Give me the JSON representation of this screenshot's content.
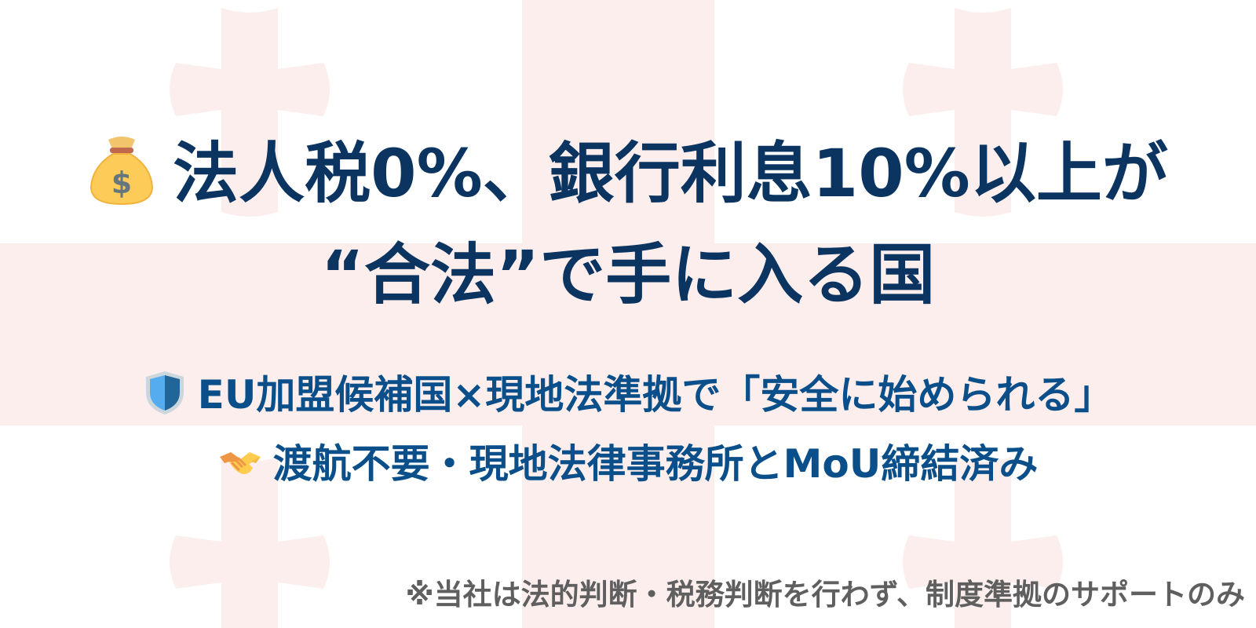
{
  "background": {
    "flag_motif": "georgian-flag-faint",
    "cross_color": "#fdeeee",
    "base_color": "#ffffff"
  },
  "headline": {
    "line1_icon": "money-bag-icon",
    "line1": "法人税0%、銀行利息10%以上が",
    "line2": "“合法”で手に入る国",
    "color": "#0b3460"
  },
  "subpoints": [
    {
      "icon": "shield-icon",
      "text": "EU加盟候補国×現地法準拠で「安全に始められる」"
    },
    {
      "icon": "handshake-icon",
      "text": "渡航不要・現地法律事務所とMoU締結済み"
    }
  ],
  "subpoint_color": "#0b4f8a",
  "disclaimer": "※当社は法的判断・税務判断を行わず、制度準拠のサポートのみ",
  "disclaimer_color": "#5f5f5f"
}
